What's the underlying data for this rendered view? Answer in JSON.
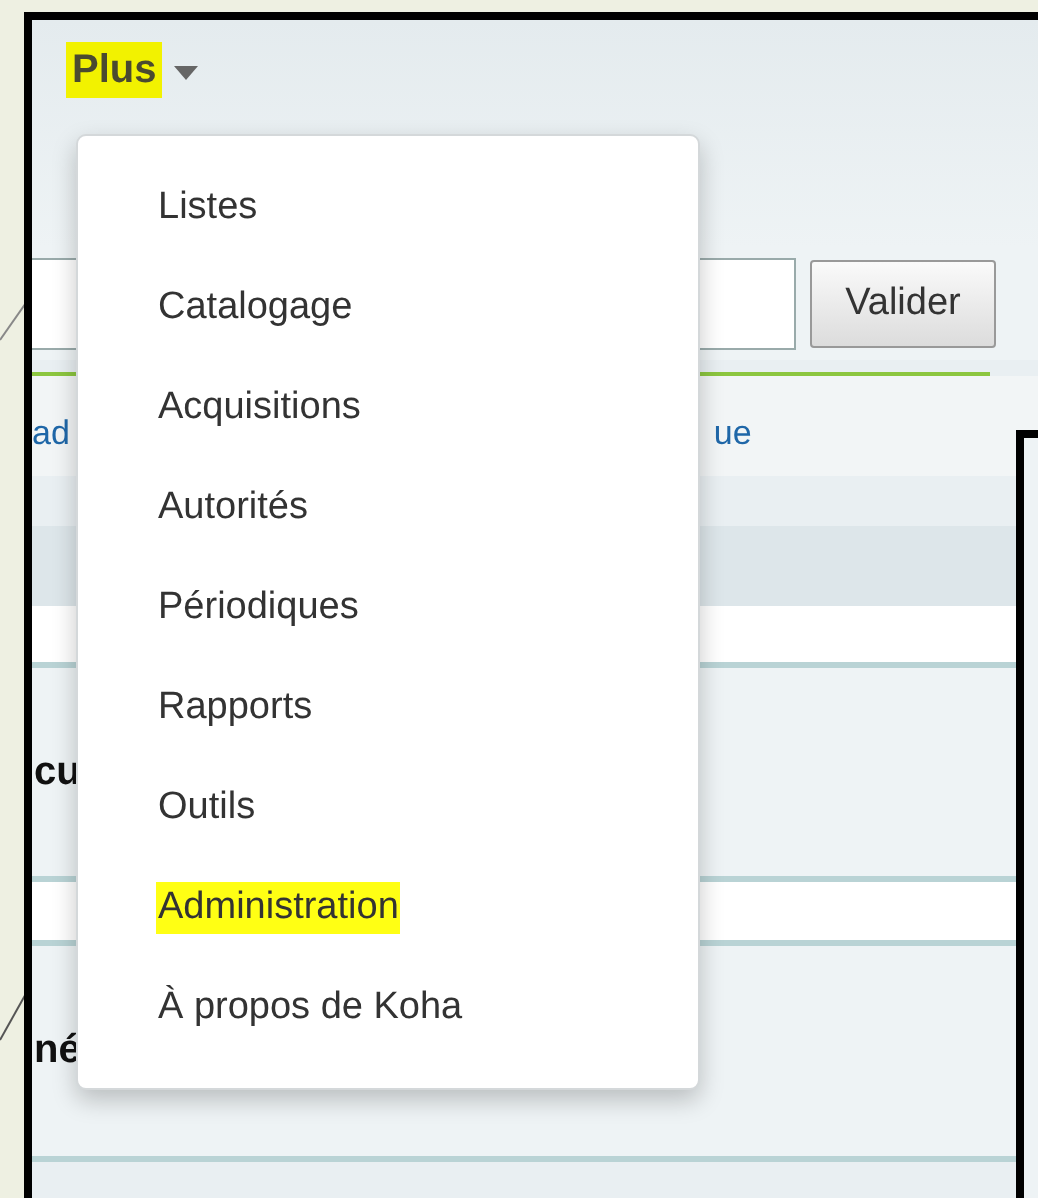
{
  "header": {
    "label": "Plus",
    "highlighted": true
  },
  "search": {
    "button": "Valider"
  },
  "link_line": {
    "left": "ad",
    "right": "ue"
  },
  "headings": [
    "cu",
    "né"
  ],
  "menu": {
    "items": [
      {
        "label": "Listes",
        "highlighted": false
      },
      {
        "label": "Catalogage",
        "highlighted": false
      },
      {
        "label": "Acquisitions",
        "highlighted": false
      },
      {
        "label": "Autorités",
        "highlighted": false
      },
      {
        "label": "Périodiques",
        "highlighted": false
      },
      {
        "label": "Rapports",
        "highlighted": false
      },
      {
        "label": "Outils",
        "highlighted": false
      },
      {
        "label": "Administration",
        "highlighted": true
      },
      {
        "label": "À propos de Koha",
        "highlighted": false
      }
    ]
  }
}
